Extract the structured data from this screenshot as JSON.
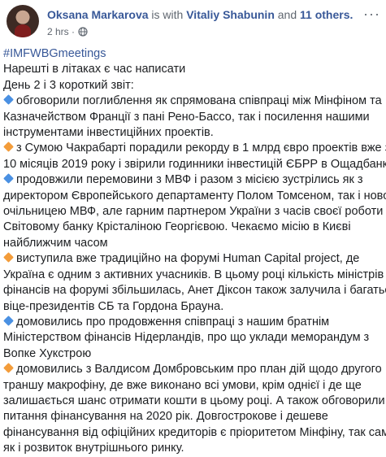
{
  "post": {
    "author": "Oksana Markarova",
    "with_text": "is with",
    "tagged": "Vitaliy Shabunin",
    "and": "and",
    "others": "11 others.",
    "time": "2 hrs ·",
    "more": "···"
  },
  "content": {
    "hashtag": "#IMFWBGmeetings",
    "intro": [
      "Нарешті в літаках є час написати",
      "День 2 і 3 короткий звіт:"
    ],
    "items": [
      {
        "marker": "blue",
        "lines": [
          "обговорили поглиблення як спрямована співпраці між Мінфіном та",
          "Казначейством Франції з пані Рено-Бассо, так і посилення нашими",
          "інструментами інвестиційних проектів."
        ]
      },
      {
        "marker": "orange",
        "lines": [
          "з Сумою Чакрабарті порадили рекорду в 1 млрд євро проектів вже за",
          "10 місяців 2019 року і звірили годинники інвестицій ЄБРР в Ощадбанк"
        ]
      },
      {
        "marker": "blue",
        "lines": [
          "продовжили перемовини з МВФ і разом з місією зустрілись як з",
          "директором Європейського департаменту Полом Томсеном, так і новою",
          "очільницею МВФ, але гарним партнером України з часів своєї роботи в",
          "Світовому банку Крісталіною Георгієвою. Чекаємо місію в Києві",
          "найближчим часом"
        ]
      },
      {
        "marker": "orange",
        "lines": [
          "виступила вже традиційно на форумі Human Capital project, де",
          "Україна є одним з активних учасників. В цьому році кількість міністрів",
          "фінансів на форумі збільшилась, Анет Діксон також залучила і багатьох",
          "віце-президентів СБ та Гордона Брауна."
        ]
      },
      {
        "marker": "blue",
        "lines": [
          "домовились про продовження співпраці з нашим братнім",
          "Міністерством фінансів Нідерландів, про що уклади меморандум з",
          "Вопке Хукстрою"
        ]
      },
      {
        "marker": "orange",
        "lines": [
          "домовились з Валдисом Домбровським про план дій щодо другого",
          "траншу макрофіну, де вже виконано всі умови, крім однієї і де ще",
          "залишається шанс отримати кошти в цьому році. А також обговорили",
          "питання фінансування на 2020 рік. Довгострокове і дешеве",
          "фінансування від офіційних кредиторів є пріоритетом Мінфіну, так само",
          "як і розвиток внутрішнього ринку."
        ]
      }
    ]
  }
}
